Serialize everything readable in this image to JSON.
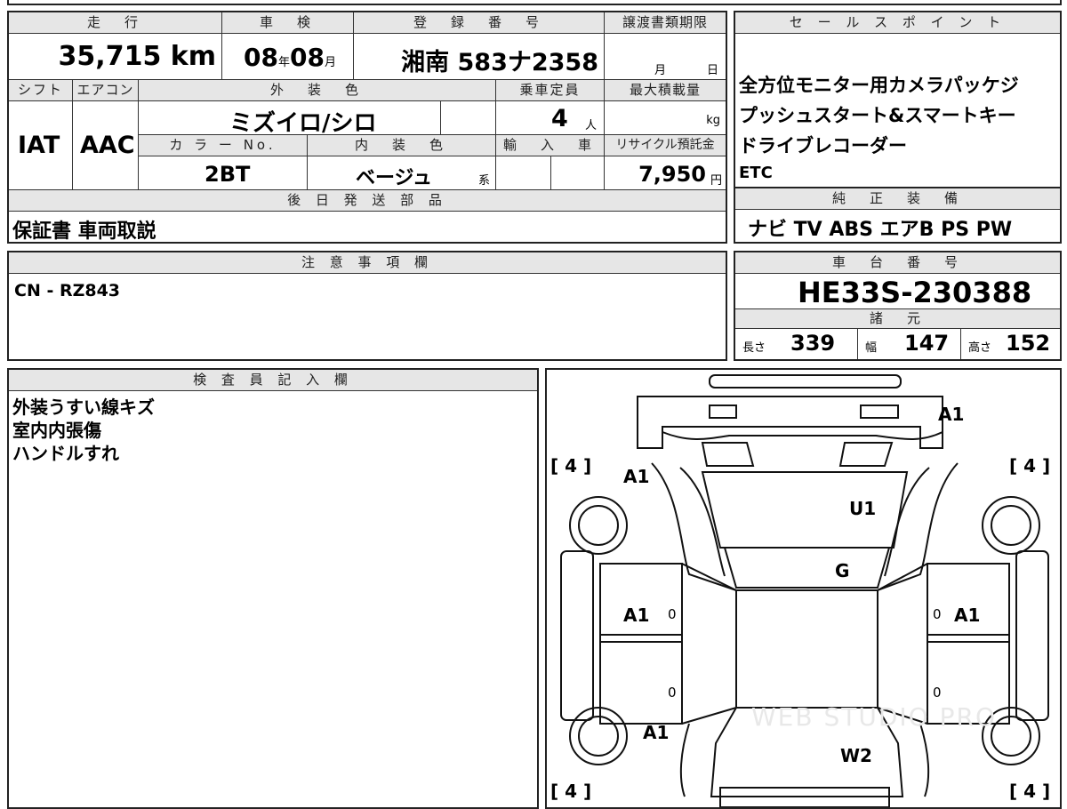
{
  "vehicle": {
    "mileage_header": "走　行",
    "mileage_value": "35,715",
    "mileage_unit": "km",
    "shaken_header": "車　検",
    "shaken_year": "08",
    "shaken_year_unit": "年",
    "shaken_month": "08",
    "shaken_month_unit": "月",
    "reg_header": "登　録　番　号",
    "reg_value": "湘南 583ナ2358",
    "transfer_header": "譲渡書類期限",
    "transfer_month": "月",
    "transfer_day": "日",
    "shift_header": "シフト",
    "shift_value": "IAT",
    "ac_header": "エアコン",
    "ac_value": "AAC",
    "exterior_header": "外　装　色",
    "exterior_value": "ミズイロ/シロ",
    "capacity_header": "乗車定員",
    "capacity_value": "4",
    "capacity_unit": "人",
    "maxload_header": "最大積載量",
    "maxload_unit": "kg",
    "colorno_header": "カ ラ ー No.",
    "colorno_value": "2BT",
    "interior_header": "内　装　色",
    "interior_value": "ベージュ",
    "interior_suffix": "系",
    "import_header": "輸　入　車",
    "recycle_header": "リサイクル預託金",
    "recycle_value": "7,950",
    "recycle_unit": "円",
    "later_header": "後 日 発 送 部 品",
    "later_value": "保証書 車両取説"
  },
  "sales_point": {
    "header": "セ ー ル ス ポ イ ン ト",
    "lines": [
      "全方位モニター用カメラパッケジ",
      "プッシュスタート&スマートキー",
      "ドライブレコーダー",
      "ETC"
    ]
  },
  "equipment": {
    "header": "純　正　装　備",
    "value": "ナビ TV ABS エアB PS PW"
  },
  "notes": {
    "header": "注 意 事 項 欄",
    "value": "CN - RZ843"
  },
  "chassis": {
    "header": "車　台　番　号",
    "value": "HE33S-230388"
  },
  "specs": {
    "header": "諸　元",
    "length_label": "長さ",
    "length_value": "339",
    "width_label": "幅",
    "width_value": "147",
    "height_label": "高さ",
    "height_value": "152"
  },
  "inspector": {
    "header": "検 査 員 記 入 欄",
    "lines": [
      "外装うすい線キズ",
      "室内内張傷",
      "ハンドルすれ"
    ]
  },
  "diagram": {
    "tire_fl": "4",
    "tire_fr": "4",
    "tire_rl": "4",
    "tire_rr": "4",
    "bracket_open": "[",
    "bracket_close": "]",
    "marks": [
      "A1",
      "A1",
      "U1",
      "G",
      "A1",
      "A1",
      "A1",
      "W2"
    ],
    "zeros": [
      "0",
      "0",
      "0",
      "0"
    ],
    "watermark": "WEB STUDIO PRO"
  }
}
